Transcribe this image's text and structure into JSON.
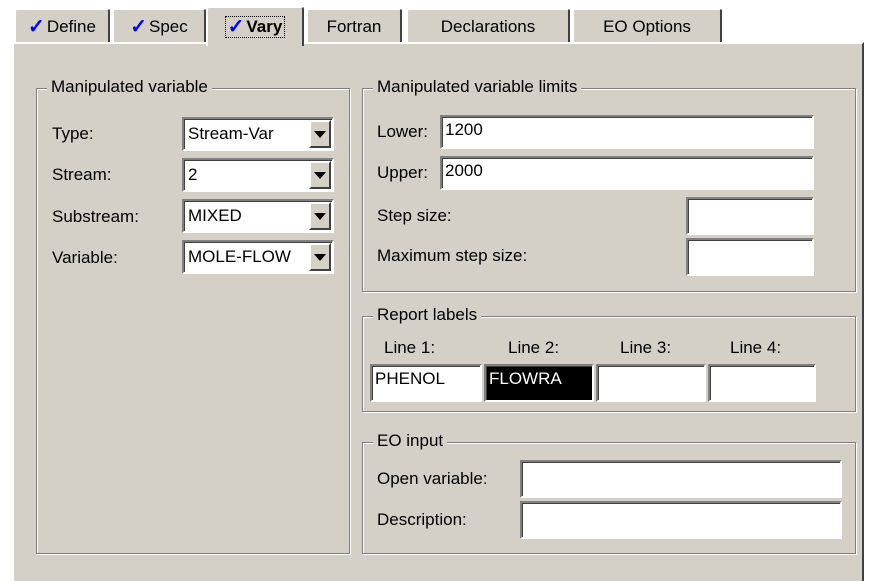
{
  "tabs": [
    {
      "label": "Define",
      "checked": true,
      "selected": false
    },
    {
      "label": "Spec",
      "checked": true,
      "selected": false
    },
    {
      "label": "Vary",
      "checked": true,
      "selected": true
    },
    {
      "label": "Fortran",
      "checked": false,
      "selected": false
    },
    {
      "label": "Declarations",
      "checked": false,
      "selected": false
    },
    {
      "label": "EO Options",
      "checked": false,
      "selected": false
    }
  ],
  "check_glyph": "✓",
  "manipulated": {
    "title": "Manipulated variable",
    "type_label": "Type:",
    "type_value": "Stream-Var",
    "stream_label": "Stream:",
    "stream_value": "2",
    "substream_label": "Substream:",
    "substream_value": "MIXED",
    "variable_label": "Variable:",
    "variable_value": "MOLE-FLOW"
  },
  "limits": {
    "title": "Manipulated variable limits",
    "lower_label": "Lower:",
    "lower_value": "1200",
    "upper_label": "Upper:",
    "upper_value": "2000",
    "step_label": "Step size:",
    "step_value": "",
    "max_step_label": "Maximum step size:",
    "max_step_value": ""
  },
  "report": {
    "title": "Report labels",
    "headers": [
      "Line 1:",
      "Line 2:",
      "Line 3:",
      "Line 4:"
    ],
    "values": [
      "PHENOL",
      "FLOWRA",
      "",
      ""
    ]
  },
  "eo": {
    "title": "EO input",
    "open_label": "Open variable:",
    "open_value": "",
    "desc_label": "Description:",
    "desc_value": ""
  },
  "colors": {
    "face": "#d4d0c8",
    "check": "#0000ff",
    "highlight_field": "#000000"
  }
}
